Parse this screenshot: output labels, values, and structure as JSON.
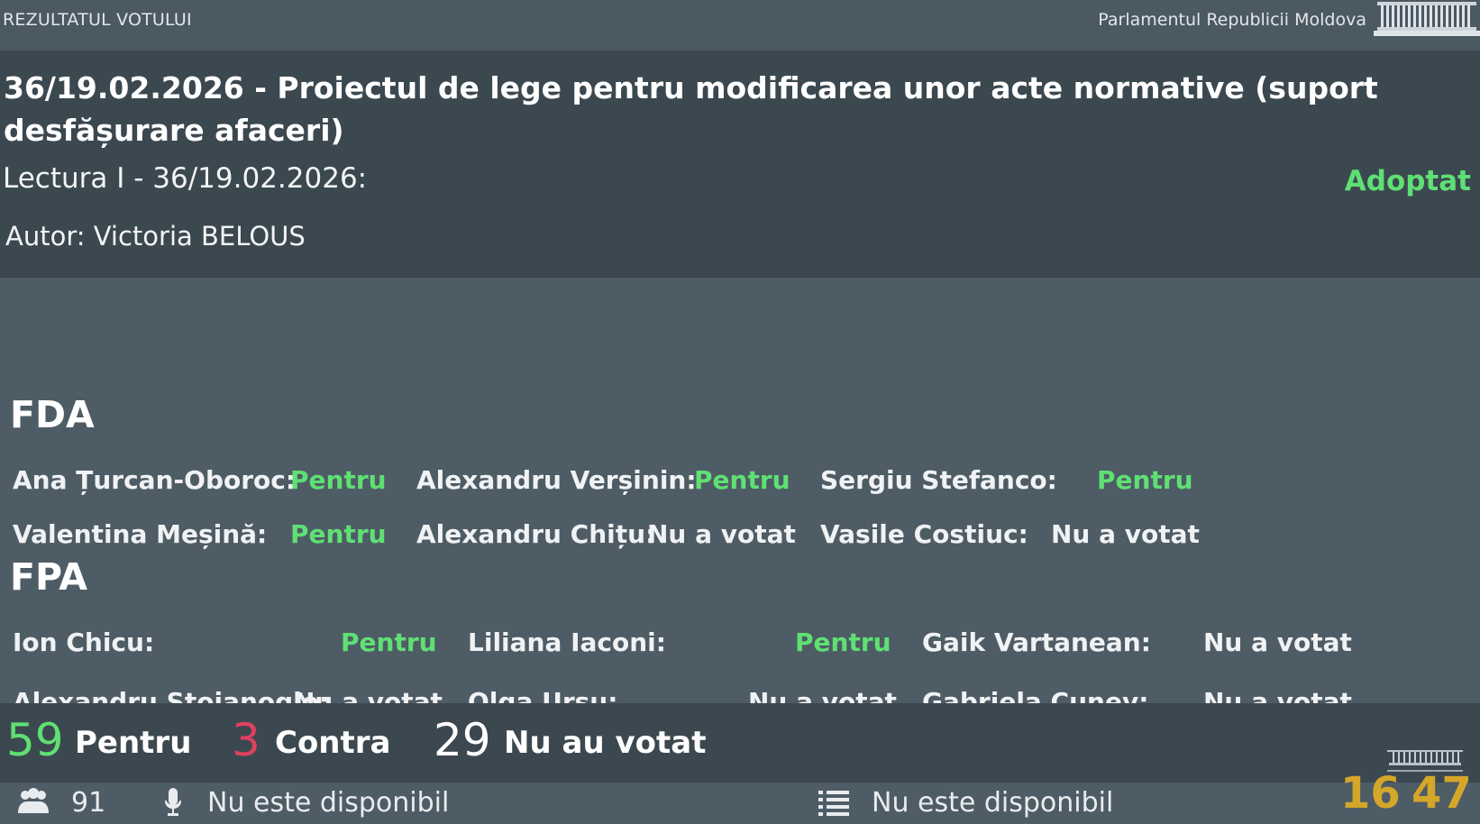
{
  "topbar": {
    "left_label": "REZULTATUL VOTULUI",
    "right_label": "Parlamentul Republicii Moldova"
  },
  "header": {
    "project_title": "36/19.02.2026 - Proiectul de lege pentru modificarea unor acte normative (suport desfășurare afaceri)",
    "reading": "Lectura I - 36/19.02.2026:",
    "status": "Adoptat",
    "author": "Autor: Victoria BELOUS"
  },
  "colors": {
    "pentru": "#5fe073",
    "contra": "#e0405f",
    "clock": "#d4a62a",
    "panel": "#3c4850",
    "background": "#4e5c66"
  },
  "factions": [
    {
      "name": "FDA",
      "members": [
        {
          "name": "Ana Țurcan-Oboroc:",
          "vote": "Pentru"
        },
        {
          "name": "Alexandru Verșinin:",
          "vote": "Pentru"
        },
        {
          "name": "Sergiu Stefanco:",
          "vote": "Pentru"
        },
        {
          "name": "Valentina Meșină:",
          "vote": "Pentru"
        },
        {
          "name": "Alexandru Chițu:",
          "vote": "Nu a votat"
        },
        {
          "name": "Vasile Costiuc:",
          "vote": "Nu a votat"
        }
      ]
    },
    {
      "name": "FPA",
      "members": [
        {
          "name": "Ion Chicu:",
          "vote": "Pentru"
        },
        {
          "name": "Liliana Iaconi:",
          "vote": "Pentru"
        },
        {
          "name": "Gaik Vartanean:",
          "vote": "Nu a votat"
        },
        {
          "name": "Alexandru Stoianoglo:",
          "vote": "Nu a votat"
        },
        {
          "name": "Olga Ursu:",
          "vote": "Nu a votat"
        },
        {
          "name": "Gabriela Cunev:",
          "vote": "Nu a votat"
        }
      ]
    }
  ],
  "summary": {
    "pentru_count": "59",
    "pentru_label": "Pentru",
    "contra_count": "3",
    "contra_label": "Contra",
    "novote_count": "29",
    "novote_label": "Nu au votat"
  },
  "footer": {
    "people_icon": "people-icon",
    "mic_icon": "microphone-icon",
    "list_icon": "list-icon",
    "members_present": "91",
    "microphone_status": "Nu este disponibil",
    "list_status": "Nu este disponibil"
  },
  "clock": {
    "hours": "16",
    "minutes": "47"
  }
}
